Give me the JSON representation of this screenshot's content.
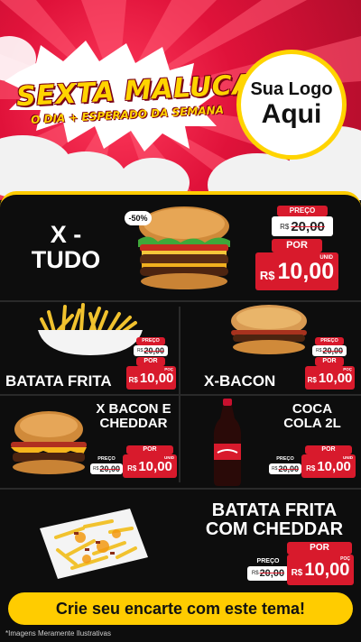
{
  "header": {
    "title": "SEXTA MALUCA!",
    "subtitle": "O DIA + ESPERADO DA SEMANA",
    "logo_line1": "Sua Logo",
    "logo_line2": "Aqui"
  },
  "colors": {
    "accent_red": "#d81a2c",
    "accent_yellow": "#ffcc00",
    "panel_bg": "#0d0d0d"
  },
  "badge": {
    "discount": "-50%"
  },
  "products": [
    {
      "id": "x-tudo",
      "name_line1": "X -",
      "name_line2": "TUDO",
      "label_preco": "PREÇO",
      "old_currency": "R$",
      "old_value": "20,00",
      "label_por": "POR",
      "currency": "R$",
      "value": "10,00",
      "unit": "UNID"
    },
    {
      "id": "batata-frita",
      "name": "BATATA FRITA",
      "label_preco": "PREÇO",
      "old_currency": "R$",
      "old_value": "20,00",
      "label_por": "POR",
      "currency": "R$",
      "value": "10,00",
      "unit": "POÇ"
    },
    {
      "id": "x-bacon",
      "name": "X-BACON",
      "label_preco": "PREÇO",
      "old_currency": "R$",
      "old_value": "20,00",
      "label_por": "POR",
      "currency": "R$",
      "value": "10,00",
      "unit": "POÇ"
    },
    {
      "id": "x-bacon-cheddar",
      "name_line1": "X BACON E",
      "name_line2": "CHEDDAR",
      "label_preco": "PREÇO",
      "old_currency": "R$",
      "old_value": "20,00",
      "label_por": "POR",
      "currency": "R$",
      "value": "10,00",
      "unit": "UNID"
    },
    {
      "id": "coca-cola",
      "name_line1": "COCA",
      "name_line2": "COLA 2L",
      "label_preco": "PREÇO",
      "old_currency": "R$",
      "old_value": "20,00",
      "label_por": "POR",
      "currency": "R$",
      "value": "10,00",
      "unit": "UNID"
    },
    {
      "id": "batata-cheddar",
      "name_line1": "BATATA FRITA",
      "name_line2": "COM CHEDDAR",
      "label_preco": "PREÇO",
      "old_currency": "R$",
      "old_value": "20,00",
      "label_por": "POR",
      "currency": "R$",
      "value": "10,00",
      "unit": "POÇ"
    }
  ],
  "footer": {
    "cta": "Crie seu encarte com este tema!",
    "disclaimer": "*Imagens Meramente Ilustrativas"
  }
}
